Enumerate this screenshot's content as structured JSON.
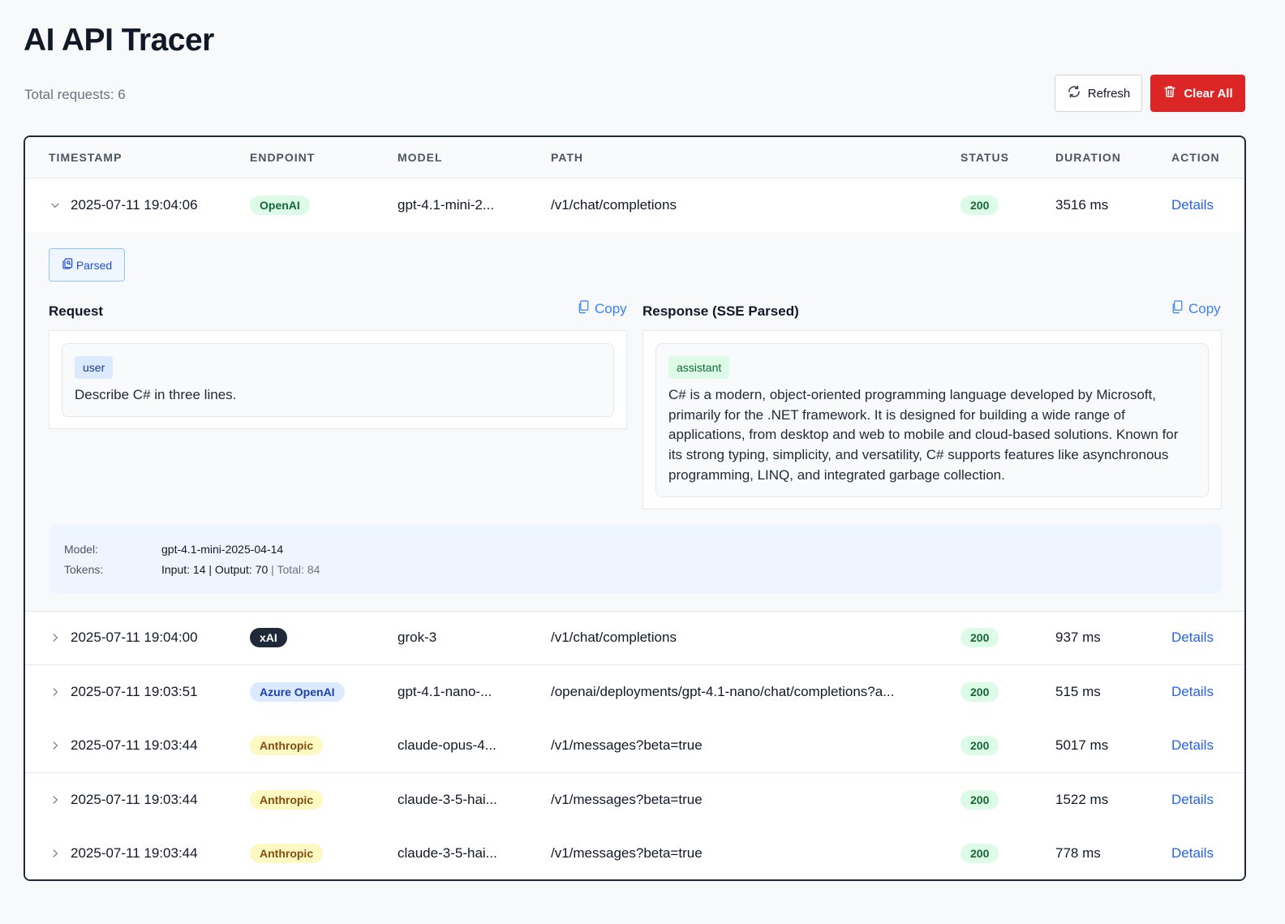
{
  "app": {
    "title": "AI API Tracer",
    "total_requests": "Total requests: 6",
    "refresh_label": "Refresh",
    "clear_label": "Clear All"
  },
  "columns": [
    "TIMESTAMP",
    "ENDPOINT",
    "MODEL",
    "PATH",
    "STATUS",
    "DURATION",
    "ACTION"
  ],
  "rows": [
    {
      "timestamp": "2025-07-11 19:04:06",
      "endpoint": "OpenAI",
      "model": "gpt-4.1-mini-2...",
      "path": "/v1/chat/completions",
      "status": "200",
      "duration": "3516 ms",
      "action": "Details",
      "expanded": true
    },
    {
      "timestamp": "2025-07-11 19:04:00",
      "endpoint": "xAI",
      "model": "grok-3",
      "path": "/v1/chat/completions",
      "status": "200",
      "duration": "937 ms",
      "action": "Details",
      "expanded": false
    },
    {
      "timestamp": "2025-07-11 19:03:51",
      "endpoint": "Azure OpenAI",
      "model": "gpt-4.1-nano-...",
      "path": "/openai/deployments/gpt-4.1-nano/chat/completions?a...",
      "status": "200",
      "duration": "515 ms",
      "action": "Details",
      "expanded": false
    },
    {
      "timestamp": "2025-07-11 19:03:44",
      "endpoint": "Anthropic",
      "model": "claude-opus-4...",
      "path": "/v1/messages?beta=true",
      "status": "200",
      "duration": "5017 ms",
      "action": "Details",
      "expanded": false
    },
    {
      "timestamp": "2025-07-11 19:03:44",
      "endpoint": "Anthropic",
      "model": "claude-3-5-hai...",
      "path": "/v1/messages?beta=true",
      "status": "200",
      "duration": "1522 ms",
      "action": "Details",
      "expanded": false
    },
    {
      "timestamp": "2025-07-11 19:03:44",
      "endpoint": "Anthropic",
      "model": "claude-3-5-hai...",
      "path": "/v1/messages?beta=true",
      "status": "200",
      "duration": "778 ms",
      "action": "Details",
      "expanded": false
    }
  ],
  "endpoint_styles": {
    "OpenAI": {
      "bg": "#dcfce7",
      "fg": "#166534"
    },
    "xAI": {
      "bg": "#1f2937",
      "fg": "#ffffff"
    },
    "Azure OpenAI": {
      "bg": "#dbeafe",
      "fg": "#1e40af"
    },
    "Anthropic": {
      "bg": "#fef9c3",
      "fg": "#854d0e"
    }
  },
  "detail": {
    "parsed_label": "Parsed",
    "request_title": "Request",
    "response_title": "Response (SSE Parsed)",
    "copy_label": "Copy",
    "request_role": "user",
    "request_lines": [
      "Describe C# in three lines."
    ],
    "response_role": "assistant",
    "response_lines": [
      "C# is a modern, object-oriented programming language developed by Microsoft,",
      "primarily for the .NET framework. It is designed for building a wide range of",
      "applications, from desktop and web to mobile and cloud-based solutions. Known for",
      "its strong typing, simplicity, and versatility, C# supports features like asynchronous",
      "programming, LINQ, and integrated garbage collection."
    ],
    "model_label": "Model:",
    "model_value": "gpt-4.1-mini-2025-04-14",
    "tokens_label": "Tokens:",
    "tokens_main": "Input: 14 | Output: 70",
    "tokens_sep": " | ",
    "tokens_total": "Total: 84"
  },
  "colors": {
    "accent": "#2563eb",
    "danger": "#dc2626",
    "status_ok_bg": "#dcfce7",
    "status_ok_fg": "#166534"
  },
  "icons": {
    "refresh": "refresh-icon",
    "clear": "trash-icon",
    "expand": "chevron-right-icon",
    "collapse": "chevron-down-icon",
    "parsed": "parsed-icon",
    "copy": "copy-icon"
  }
}
